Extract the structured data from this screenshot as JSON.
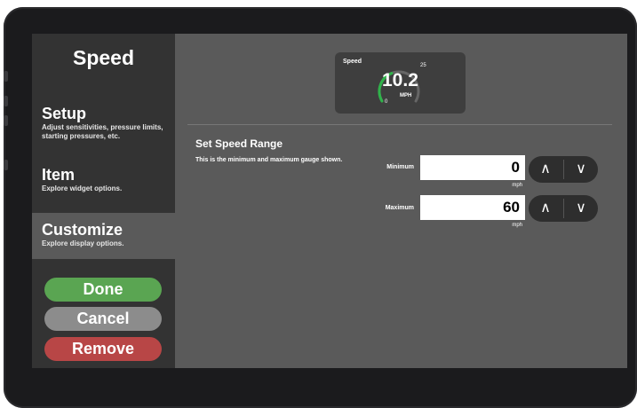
{
  "sidebar": {
    "title": "Speed",
    "items": [
      {
        "label": "Setup",
        "desc": "Adjust sensitivities, pressure limits, starting pressures, etc."
      },
      {
        "label": "Item",
        "desc": "Explore widget options."
      },
      {
        "label": "Customize",
        "desc": "Explore display options."
      }
    ],
    "buttons": {
      "done": "Done",
      "cancel": "Cancel",
      "remove": "Remove"
    }
  },
  "gauge": {
    "label": "Speed",
    "value": "10.2",
    "unit": "MPH",
    "min": "0",
    "max": "25",
    "fill_fraction": 0.41
  },
  "range": {
    "title": "Set Speed Range",
    "desc": "This is the minimum and maximum gauge shown.",
    "minimum": {
      "label": "Minimum",
      "value": "0",
      "unit": "mph"
    },
    "maximum": {
      "label": "Maximum",
      "value": "60",
      "unit": "mph"
    }
  },
  "stepper": {
    "up": "∧",
    "down": "∨"
  },
  "colors": {
    "done": "#5aa552",
    "cancel": "#8c8c8c",
    "remove": "#b84646",
    "gauge_arc": "#2fb34a"
  }
}
